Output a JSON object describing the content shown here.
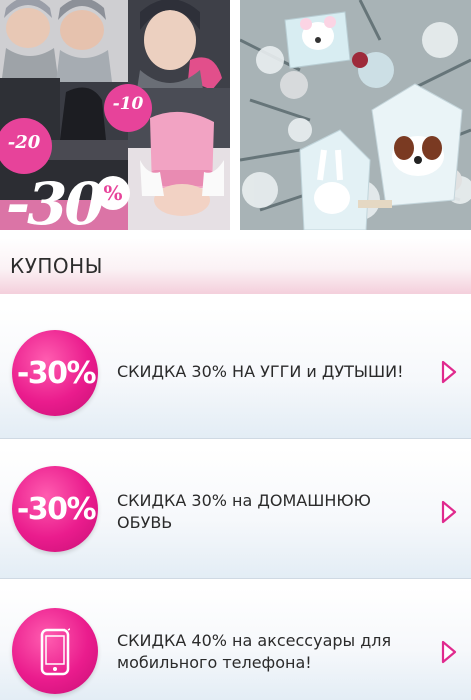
{
  "banners": {
    "left_badges": {
      "b20": "-20",
      "b10": "-10",
      "b30": "-30",
      "pct": "%"
    }
  },
  "coupons_header": {
    "title": "КУПОНЫ"
  },
  "coupons": [
    {
      "badge": "-30%",
      "text": "СКИДКА 30% НА УГГИ и ДУТЫШИ!",
      "icon": "percent-badge"
    },
    {
      "badge": "-30%",
      "text_line1": "СКИДКА 30% на ДОМАШНЮЮ",
      "text_line2": "ОБУВЬ",
      "icon": "percent-badge"
    },
    {
      "text_line1": "СКИДКА 40% на аксессуары для",
      "text_line2": "мобильного телефона!",
      "icon": "smartphone-icon"
    }
  ],
  "colors": {
    "accent_pink": "#ea1c8d",
    "header_pink": "#f4cfdc",
    "card_blue": "#e3edf5"
  }
}
